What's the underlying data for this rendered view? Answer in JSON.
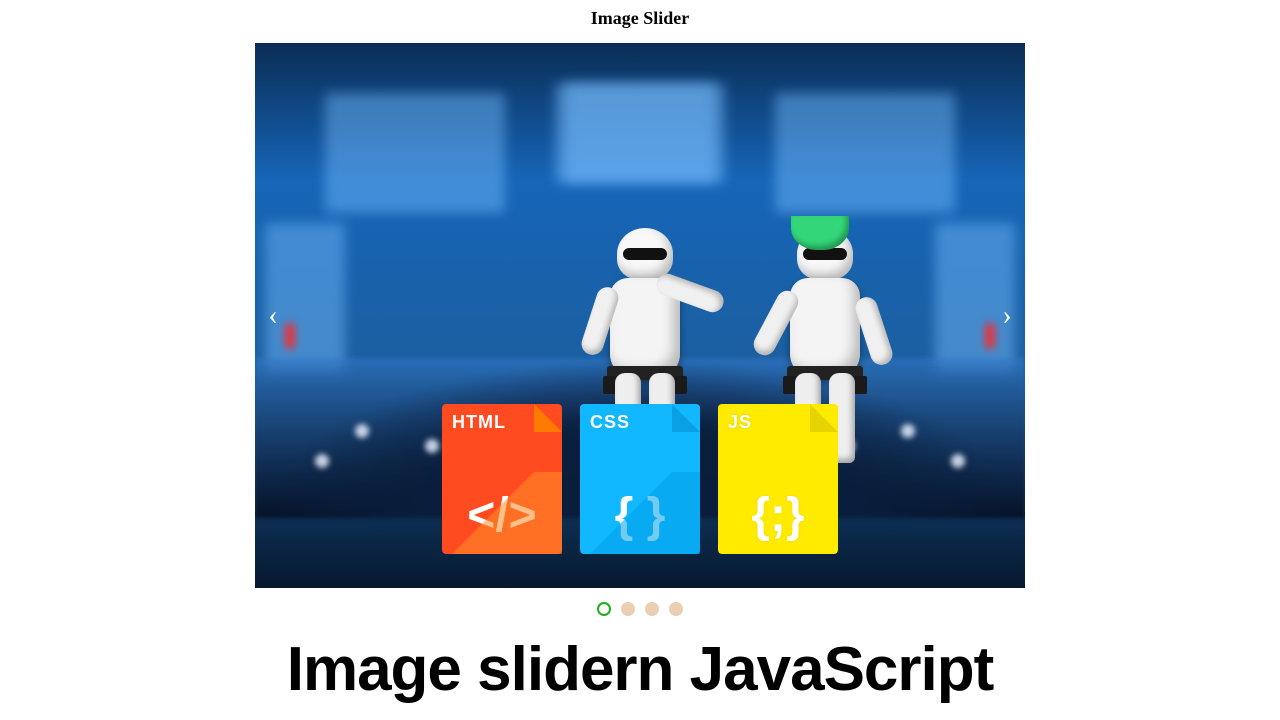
{
  "header": {
    "title": "Image Slider"
  },
  "slider": {
    "prev_glyph": "‹",
    "next_glyph": "›",
    "current_index": 0,
    "dot_count": 4,
    "badges": [
      {
        "label": "HTML",
        "glyph": "</>",
        "kind": "html"
      },
      {
        "label": "CSS",
        "glyph": "{ }",
        "kind": "css"
      },
      {
        "label": "JS",
        "glyph": "{;}",
        "kind": "js"
      }
    ]
  },
  "footer": {
    "heading": "Image slidern JavaScript"
  }
}
